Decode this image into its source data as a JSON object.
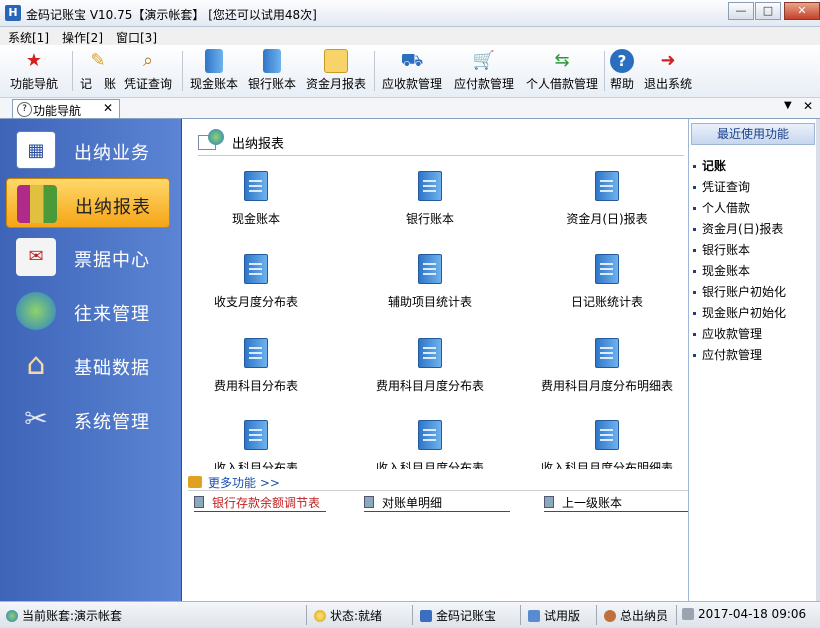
{
  "window": {
    "title": "金码记账宝   V10.75【演示帐套】  [您还可以试用48次]",
    "app_icon_glyph": "H"
  },
  "menu": [
    "系统[1]",
    "操作[2]",
    "窗口[3]"
  ],
  "toolbar": [
    {
      "label": "功能导航",
      "icon": "star-icon"
    },
    {
      "label": "记　账",
      "icon": "pencil-icon"
    },
    {
      "label": "凭证查询",
      "icon": "magnifier-icon"
    },
    {
      "label": "现金账本",
      "icon": "ledger-icon"
    },
    {
      "label": "银行账本",
      "icon": "ledger-icon"
    },
    {
      "label": "资金月报表",
      "icon": "calendar-icon"
    },
    {
      "label": "应收款管理",
      "icon": "truck-icon"
    },
    {
      "label": "应付款管理",
      "icon": "cart-icon"
    },
    {
      "label": "个人借款管理",
      "icon": "exchange-icon"
    },
    {
      "label": "帮助",
      "icon": "help-icon"
    },
    {
      "label": "退出系统",
      "icon": "exit-door-icon"
    }
  ],
  "tab": {
    "label": "功能导航",
    "close": "✕"
  },
  "leftnav": [
    {
      "label": "出纳业务",
      "icon": "calendar-icon",
      "active": false
    },
    {
      "label": "出纳报表",
      "icon": "books-icon",
      "active": true
    },
    {
      "label": "票据中心",
      "icon": "envelope-icon",
      "active": false
    },
    {
      "label": "往来管理",
      "icon": "globe-icon",
      "active": false
    },
    {
      "label": "基础数据",
      "icon": "house-icon",
      "active": false
    },
    {
      "label": "系统管理",
      "icon": "tools-icon",
      "active": false
    }
  ],
  "main": {
    "header": "出纳报表",
    "reports": [
      "现金账本",
      "银行账本",
      "资金月(日)报表",
      "收支月度分布表",
      "辅助项目统计表",
      "日记账统计表",
      "费用科目分布表",
      "费用科目月度分布表",
      "费用科目月度分布明细表",
      "收入科目分布表",
      "收入科目月度分布表",
      "收入科目月度分布明细表"
    ],
    "more_label": "更多功能 >>",
    "more_links": [
      "银行存款余额调节表",
      "对账单明细",
      "上一级账本"
    ]
  },
  "recent": {
    "title": "最近使用功能",
    "items": [
      "记账",
      "凭证查询",
      "个人借款",
      "资金月(日)报表",
      "银行账本",
      "现金账本",
      "银行账户初始化",
      "现金账户初始化",
      "应收款管理",
      "应付款管理"
    ]
  },
  "status": {
    "account": "当前账套:演示帐套",
    "state": "状态:就绪",
    "app": "金码记账宝",
    "edition": "试用版",
    "user": "总出纳员",
    "datetime": "2017-04-18 09:06"
  }
}
